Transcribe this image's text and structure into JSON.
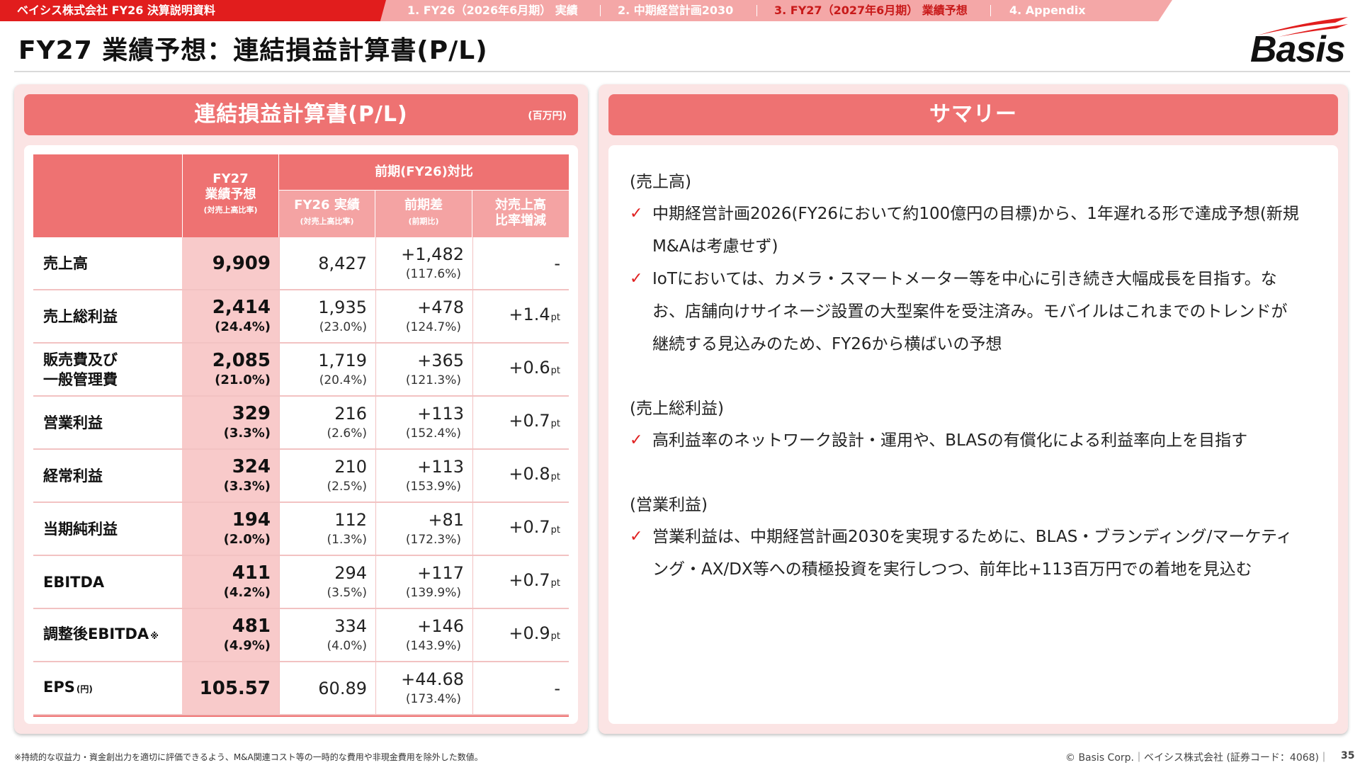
{
  "topbar": {
    "doc_title": "ベイシス株式会社 FY26 決算説明資料",
    "tabs": [
      {
        "label": "1. FY26（2026年6月期） 実績"
      },
      {
        "label": "2. 中期経営計画2030"
      },
      {
        "label": "3. FY27（2027年6月期） 業績予想"
      },
      {
        "label": "4. Appendix"
      }
    ],
    "active_tab": 2
  },
  "page": {
    "title": "FY27 業績予想：連結損益計算書(P/L)",
    "logo_text": "Basis"
  },
  "pl_panel": {
    "title": "連結損益計算書(P/L)",
    "unit": "(百万円)",
    "header": {
      "fy27_line1": "FY27",
      "fy27_line2": "業績予想",
      "fy27_line3": "(対売上高比率)",
      "group": "前期(FY26)対比",
      "col1_line1": "FY26 実績",
      "col1_line2": "(対売上高比率)",
      "col2_line1": "前期差",
      "col2_line2": "(前期比)",
      "col3_line1": "対売上高",
      "col3_line2": "比率増減"
    },
    "rows": [
      {
        "label": "売上高",
        "label2": "",
        "label_suffix": "",
        "fy27": "9,909",
        "fy27_ratio": "",
        "fy26": "8,427",
        "fy26_ratio": "",
        "diff": "+1,482",
        "diff_ratio": "(117.6%)",
        "ratio_change": "-",
        "ratio_unit": ""
      },
      {
        "label": "売上総利益",
        "label2": "",
        "label_suffix": "",
        "fy27": "2,414",
        "fy27_ratio": "(24.4%)",
        "fy26": "1,935",
        "fy26_ratio": "(23.0%)",
        "diff": "+478",
        "diff_ratio": "(124.7%)",
        "ratio_change": "+1.4",
        "ratio_unit": "pt"
      },
      {
        "label": "販売費及び",
        "label2": "一般管理費",
        "label_suffix": "",
        "fy27": "2,085",
        "fy27_ratio": "(21.0%)",
        "fy26": "1,719",
        "fy26_ratio": "(20.4%)",
        "diff": "+365",
        "diff_ratio": "(121.3%)",
        "ratio_change": "+0.6",
        "ratio_unit": "pt"
      },
      {
        "label": "営業利益",
        "label2": "",
        "label_suffix": "",
        "fy27": "329",
        "fy27_ratio": "(3.3%)",
        "fy26": "216",
        "fy26_ratio": "(2.6%)",
        "diff": "+113",
        "diff_ratio": "(152.4%)",
        "ratio_change": "+0.7",
        "ratio_unit": "pt"
      },
      {
        "label": "経常利益",
        "label2": "",
        "label_suffix": "",
        "fy27": "324",
        "fy27_ratio": "(3.3%)",
        "fy26": "210",
        "fy26_ratio": "(2.5%)",
        "diff": "+113",
        "diff_ratio": "(153.9%)",
        "ratio_change": "+0.8",
        "ratio_unit": "pt"
      },
      {
        "label": "当期純利益",
        "label2": "",
        "label_suffix": "",
        "fy27": "194",
        "fy27_ratio": "(2.0%)",
        "fy26": "112",
        "fy26_ratio": "(1.3%)",
        "diff": "+81",
        "diff_ratio": "(172.3%)",
        "ratio_change": "+0.7",
        "ratio_unit": "pt"
      },
      {
        "label": "EBITDA",
        "label2": "",
        "label_suffix": "",
        "fy27": "411",
        "fy27_ratio": "(4.2%)",
        "fy26": "294",
        "fy26_ratio": "(3.5%)",
        "diff": "+117",
        "diff_ratio": "(139.9%)",
        "ratio_change": "+0.7",
        "ratio_unit": "pt"
      },
      {
        "label": "調整後EBITDA",
        "label2": "",
        "label_suffix": "※",
        "fy27": "481",
        "fy27_ratio": "(4.9%)",
        "fy26": "334",
        "fy26_ratio": "(4.0%)",
        "diff": "+146",
        "diff_ratio": "(143.9%)",
        "ratio_change": "+0.9",
        "ratio_unit": "pt"
      },
      {
        "label": "EPS",
        "label2": "",
        "label_suffix": "(円)",
        "fy27": "105.57",
        "fy27_ratio": "",
        "fy26": "60.89",
        "fy26_ratio": "",
        "diff": "+44.68",
        "diff_ratio": "(173.4%)",
        "ratio_change": "-",
        "ratio_unit": ""
      }
    ]
  },
  "summary_panel": {
    "title": "サマリー",
    "sections": [
      {
        "heading": "(売上高)",
        "bullets": [
          {
            "lines": [
              "中期経営計画2026(FY26において約100億円の目標)から、1年遅れる形で達成予想(新規",
              "M&Aは考慮せず)"
            ]
          },
          {
            "lines": [
              "IoTにおいては、カメラ・スマートメーター等を中心に引き続き大幅成長を目指す。な",
              "お、店舗向けサイネージ設置の大型案件を受注済み。モバイルはこれまでのトレンドが",
              "継続する見込みのため、FY26から横ばいの予想"
            ]
          }
        ]
      },
      {
        "heading": "(売上総利益)",
        "bullets": [
          {
            "lines": [
              "高利益率のネットワーク設計・運用や、BLASの有償化による利益率向上を目指す"
            ]
          }
        ]
      },
      {
        "heading": "(営業利益)",
        "bullets": [
          {
            "lines": [
              "営業利益は、中期経営計画2030を実現するために、BLAS・ブランディング/マーケティ",
              "ング・AX/DX等への積極投資を実行しつつ、前年比+113百万円での着地を見込む"
            ]
          }
        ]
      }
    ],
    "check_glyph": "✓"
  },
  "footer": {
    "footnote": "※持続的な収益力・資金創出力を適切に評価できるよう、M&A関連コスト等の一時的な費用や非現金費用を除外した数値。",
    "copyright": "© Basis Corp.｜ベイシス株式会社 (証券コード：4068)｜",
    "page_number": "35"
  },
  "colors": {
    "brand_red": "#e11d1d",
    "panel_header": "#ee7272",
    "panel_bg": "#fbe4e4",
    "fy27_column": "#f8caca",
    "check": "#e02020"
  }
}
